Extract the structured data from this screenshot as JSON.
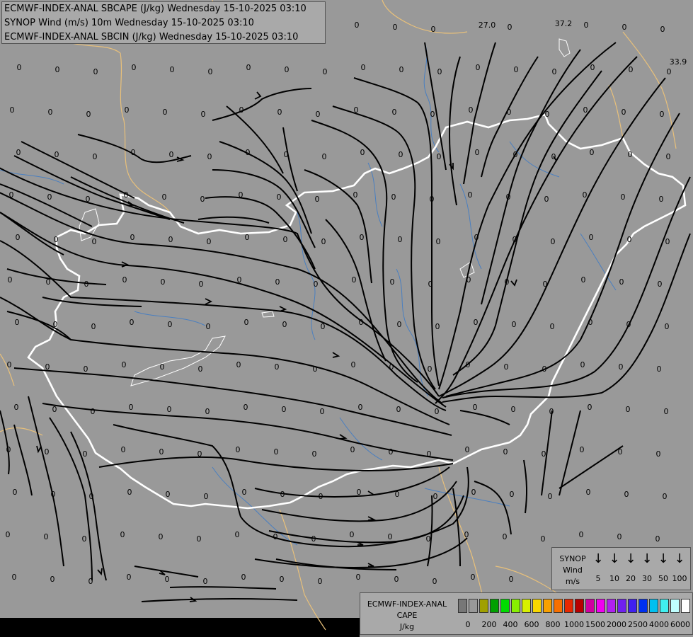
{
  "title": {
    "line1": "ECMWF-INDEX-ANAL SBCAPE (J/kg) Wednesday 15-10-2025 03:10",
    "line2": "SYNOP Wind (m/s) 10m Wednesday 15-10-2025 03:10",
    "line3": "ECMWF-INDEX-ANAL SBCIN (J/kg) Wednesday 15-10-2025 03:10"
  },
  "colors": {
    "background": "#999999",
    "border_national": "#ffffff",
    "border_neighbor": "#e8c07a",
    "rivers": "#4a7fc0",
    "streamlines": "#000000"
  },
  "cape_labels_nonzero": [
    "27.0",
    "37.2",
    "33.9"
  ],
  "synop_legend": {
    "label": [
      "SYNOP",
      "Wind",
      "m/s"
    ],
    "values": [
      "5",
      "10",
      "20",
      "30",
      "50",
      "100"
    ]
  },
  "cape_legend": {
    "label": [
      "ECMWF-INDEX-ANAL",
      "CAPE",
      "J/kg"
    ],
    "swatches": [
      "#777777",
      "#999999",
      "#a0a000",
      "#00a000",
      "#00dc00",
      "#88f000",
      "#d8f000",
      "#f8d800",
      "#f8a000",
      "#f87000",
      "#e82800",
      "#b80000",
      "#d000a0",
      "#f000f0",
      "#b020f0",
      "#7020f0",
      "#4020f0",
      "#0030f0",
      "#00c0f0",
      "#40f0f0",
      "#c0ffff",
      "#ffffff"
    ],
    "ticks": [
      "0",
      "200",
      "400",
      "600",
      "800",
      "1000",
      "1500",
      "2000",
      "2500",
      "4000",
      "6000"
    ]
  }
}
